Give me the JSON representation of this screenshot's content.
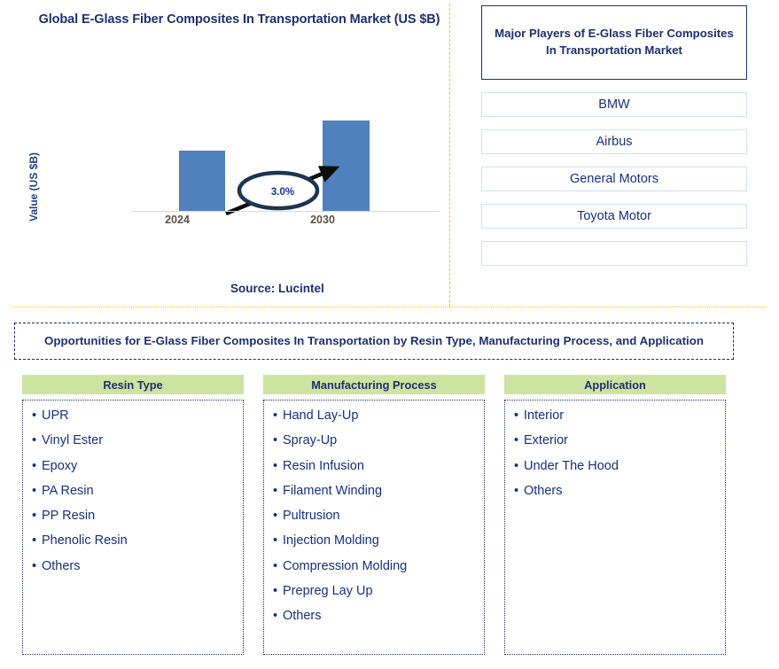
{
  "chart_panel": {
    "title": "Global E-Glass Fiber Composites In Transportation Market (US $B)",
    "source": "Source: Lucintel"
  },
  "chart_data": {
    "type": "bar",
    "title": "Global E-Glass Fiber Composites In Transportation Market (US $B)",
    "categories": [
      "2024",
      "2030"
    ],
    "values": [
      69,
      103
    ],
    "xlabel": "",
    "ylabel": "Value (US $B)",
    "grid": false,
    "legend": "none",
    "bar_color": "#4f81bd",
    "annotations": [
      {
        "name": "cagr-callout",
        "text": "3.0%",
        "shape": "ellipse-with-arrow"
      }
    ],
    "axis_labels": {
      "y_title": "Value (US $B)",
      "x_ticks": [
        "2024",
        "2030"
      ]
    },
    "source": "Source: Lucintel"
  },
  "players_panel": {
    "header": "Major Players of E-Glass Fiber Composites In Transportation Market",
    "rows": [
      "BMW",
      "Airbus",
      "General Motors",
      "Toyota Motor",
      ""
    ]
  },
  "opportunities": {
    "header": "Opportunities for E-Glass Fiber Composites In Transportation by Resin Type, Manufacturing Process, and Application",
    "bullet_glyph": "•",
    "columns": [
      {
        "title": "Resin Type",
        "items": [
          "UPR",
          "Vinyl Ester",
          "Epoxy",
          "PA Resin",
          "PP Resin",
          "Phenolic Resin",
          "Others"
        ]
      },
      {
        "title": "Manufacturing Process",
        "items": [
          "Hand Lay-Up",
          "Spray-Up",
          "Resin Infusion",
          "Filament Winding",
          "Pultrusion",
          "Injection Molding",
          "Compression Molding",
          "Prepreg Lay Up",
          "Others"
        ]
      },
      {
        "title": "Application",
        "items": [
          "Interior",
          "Exterior",
          "Under The Hood",
          "Others"
        ]
      }
    ]
  },
  "colors": {
    "navy": "#1f2f6e",
    "bar_blue": "#4f81bd",
    "header_green": "#cde4a0",
    "divider_orange": "#ffc000",
    "row_border_blue": "#cfe0f0"
  }
}
